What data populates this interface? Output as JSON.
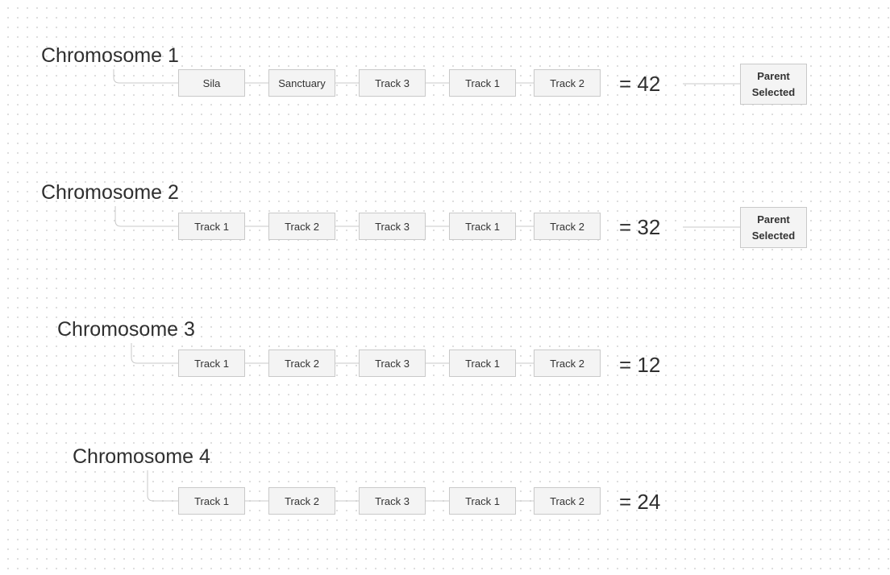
{
  "chromosomes": [
    {
      "title": "Chromosome 1",
      "tracks": [
        "Sila",
        "Sanctuary",
        "Track 3",
        "Track 1",
        "Track 2"
      ],
      "score": "= 42",
      "badge": "Parent\nSelected"
    },
    {
      "title": "Chromosome 2",
      "tracks": [
        "Track 1",
        "Track 2",
        "Track 3",
        "Track 1",
        "Track 2"
      ],
      "score": "= 32",
      "badge": "Parent\nSelected"
    },
    {
      "title": "Chromosome 3",
      "tracks": [
        "Track 1",
        "Track 2",
        "Track 3",
        "Track 1",
        "Track 2"
      ],
      "score": "= 12",
      "badge": null
    },
    {
      "title": "Chromosome 4",
      "tracks": [
        "Track 1",
        "Track 2",
        "Track 3",
        "Track 1",
        "Track 2"
      ],
      "score": "= 24",
      "badge": null
    }
  ],
  "colors": {
    "box_fill": "#f4f4f4",
    "box_border": "#c9c9c9",
    "connector": "#c9c9c9",
    "text": "#2f2f2f"
  }
}
